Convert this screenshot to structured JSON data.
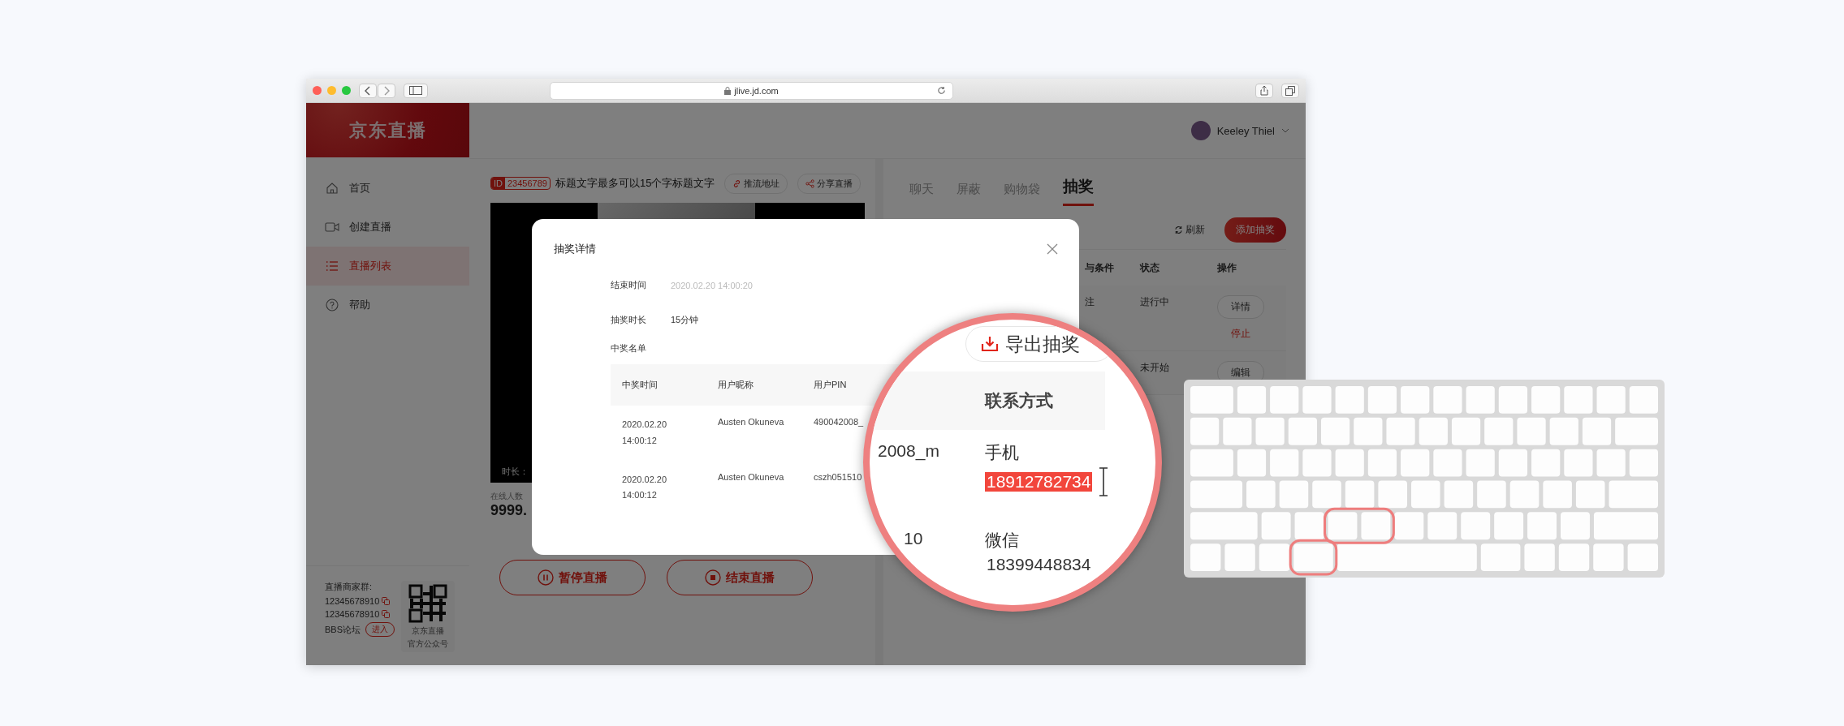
{
  "browser": {
    "url": "jlive.jd.com"
  },
  "brand": "京东直播",
  "user": {
    "name": "Keeley Thiel"
  },
  "nav": [
    {
      "label": "首页",
      "selected": false
    },
    {
      "label": "创建直播",
      "selected": false
    },
    {
      "label": "直播列表",
      "selected": true
    },
    {
      "label": "帮助",
      "selected": false
    }
  ],
  "sidebar_footer": {
    "group_label": "直播商家群:",
    "numbers": [
      "12345678910",
      "12345678910"
    ],
    "forum_label": "BBS论坛",
    "forum_button": "进入",
    "qr_caption": [
      "京东直播",
      "官方公众号"
    ]
  },
  "stream": {
    "id_label": "ID",
    "id": "23456789",
    "title": "标题文字最多可以15个字标题文字",
    "actions": [
      "推流地址",
      "分享直播"
    ],
    "duration_label": "时长：",
    "online_label": "在线人数",
    "online_count": "9999.",
    "controls": [
      "暂停直播",
      "结束直播"
    ]
  },
  "panel": {
    "tabs": [
      {
        "label": "聊天",
        "selected": false
      },
      {
        "label": "屏蔽",
        "selected": false
      },
      {
        "label": "购物袋",
        "selected": false
      },
      {
        "label": "抽奖",
        "selected": true
      }
    ],
    "refresh": "刷新",
    "add_button": "添加抽奖",
    "columns": [
      "与条件",
      "状态",
      "操作"
    ],
    "rows": [
      {
        "column_1": "注",
        "status": "进行中",
        "actions": [
          {
            "label": "详情",
            "kind": "button"
          },
          {
            "label": "停止",
            "kind": "link"
          }
        ]
      },
      {
        "status": "未开始",
        "actions": [
          {
            "label": "编辑",
            "kind": "button"
          }
        ]
      }
    ]
  },
  "modal": {
    "title": "抽奖详情",
    "fields": [
      {
        "label": "结束时间",
        "value": "2020.02.20 14:00:20",
        "muted": true
      },
      {
        "label": "抽奖时长",
        "value": "15分钟",
        "muted": false
      }
    ],
    "winners_label": "中奖名单",
    "columns": [
      "中奖时间",
      "用户昵称",
      "用户PIN"
    ],
    "rows": [
      {
        "time": "2020.02.20 14:00:12",
        "nickname": "Austen Okuneva",
        "pin": "490042008_"
      },
      {
        "time": "2020.02.20 14:00:12",
        "nickname": "Austen Okuneva",
        "pin": "cszh051510"
      }
    ]
  },
  "magnifier": {
    "export_button": "导出抽奖",
    "column": "联系方式",
    "rows": [
      {
        "pin_tail": "2008_m",
        "type": "手机",
        "contact": "18912782734",
        "selected": true
      },
      {
        "pin_tail": "10",
        "type": "微信",
        "contact": "18399448834",
        "selected": false
      }
    ]
  }
}
